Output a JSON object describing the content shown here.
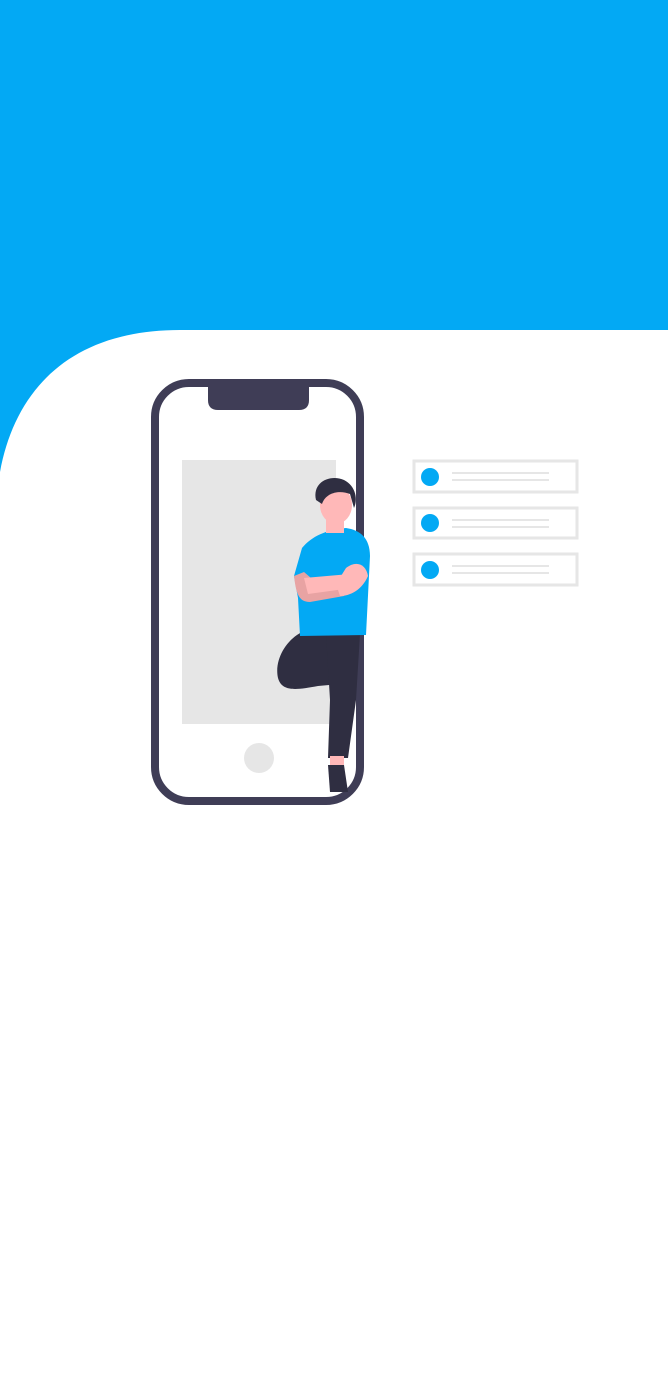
{
  "theme": {
    "accent": "#03a9f4",
    "background": "#ffffff",
    "phone_frame": "#3f3d56",
    "phone_screen": "#e6e6e6",
    "skin": "#ffb8b8",
    "hair": "#2f2e41",
    "pants": "#2f2e41",
    "list_border": "#e6e6e6"
  },
  "illustration": {
    "phone_icon": "smartphone-icon",
    "person_icon": "person-leaning-icon",
    "list_items": [
      {
        "bullet_icon": "bullet-dot-icon"
      },
      {
        "bullet_icon": "bullet-dot-icon"
      },
      {
        "bullet_icon": "bullet-dot-icon"
      }
    ]
  }
}
